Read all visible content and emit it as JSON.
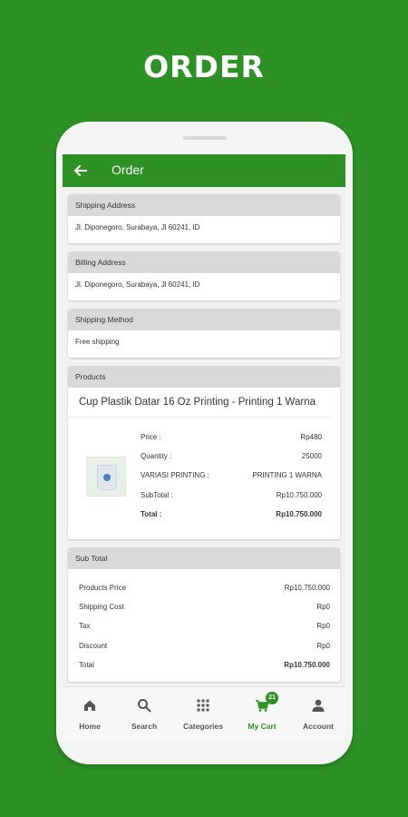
{
  "hero": {
    "title": "ORDER"
  },
  "appbar": {
    "title": "Order"
  },
  "shipping_address": {
    "header": "Shipping Address",
    "value": "Jl. Diponegoro, Surabaya, Jl 60241, ID"
  },
  "billing_address": {
    "header": "Billing Address",
    "value": "Jl. Diponegoro, Surabaya, Jl 60241, ID"
  },
  "shipping_method": {
    "header": "Shipping Method",
    "value": "Free shipping"
  },
  "products": {
    "header": "Products",
    "item_title": "Cup Plastik Datar 16 Oz Printing - Printing 1 Warna",
    "rows": [
      {
        "label": "Price :",
        "value": "Rp480"
      },
      {
        "label": "Quantity :",
        "value": "25000"
      },
      {
        "label": "VARIASI PRINTING :",
        "value": "PRINTING 1 WARNA"
      },
      {
        "label": "SubTotal :",
        "value": "Rp10.750.000"
      },
      {
        "label": "Total :",
        "value": "Rp10.750.000"
      }
    ]
  },
  "subtotal": {
    "header": "Sub Total",
    "rows": [
      {
        "label": "Products Price",
        "value": "Rp10.750.000"
      },
      {
        "label": "Shipping Cost",
        "value": "Rp0"
      },
      {
        "label": "Tax",
        "value": "Rp0"
      },
      {
        "label": "Discount",
        "value": "Rp0"
      },
      {
        "label": "Total",
        "value": "Rp10.750.000"
      }
    ]
  },
  "bottom_nav": {
    "home": "Home",
    "search": "Search",
    "categories": "Categories",
    "cart": "My Cart",
    "cart_badge": "21",
    "account": "Account"
  },
  "colors": {
    "brand_green": "#2d9125",
    "header_gray": "#d9d9d9"
  },
  "icons": [
    "back-arrow-icon",
    "home-icon",
    "search-icon",
    "grid-icon",
    "cart-icon",
    "person-icon"
  ]
}
